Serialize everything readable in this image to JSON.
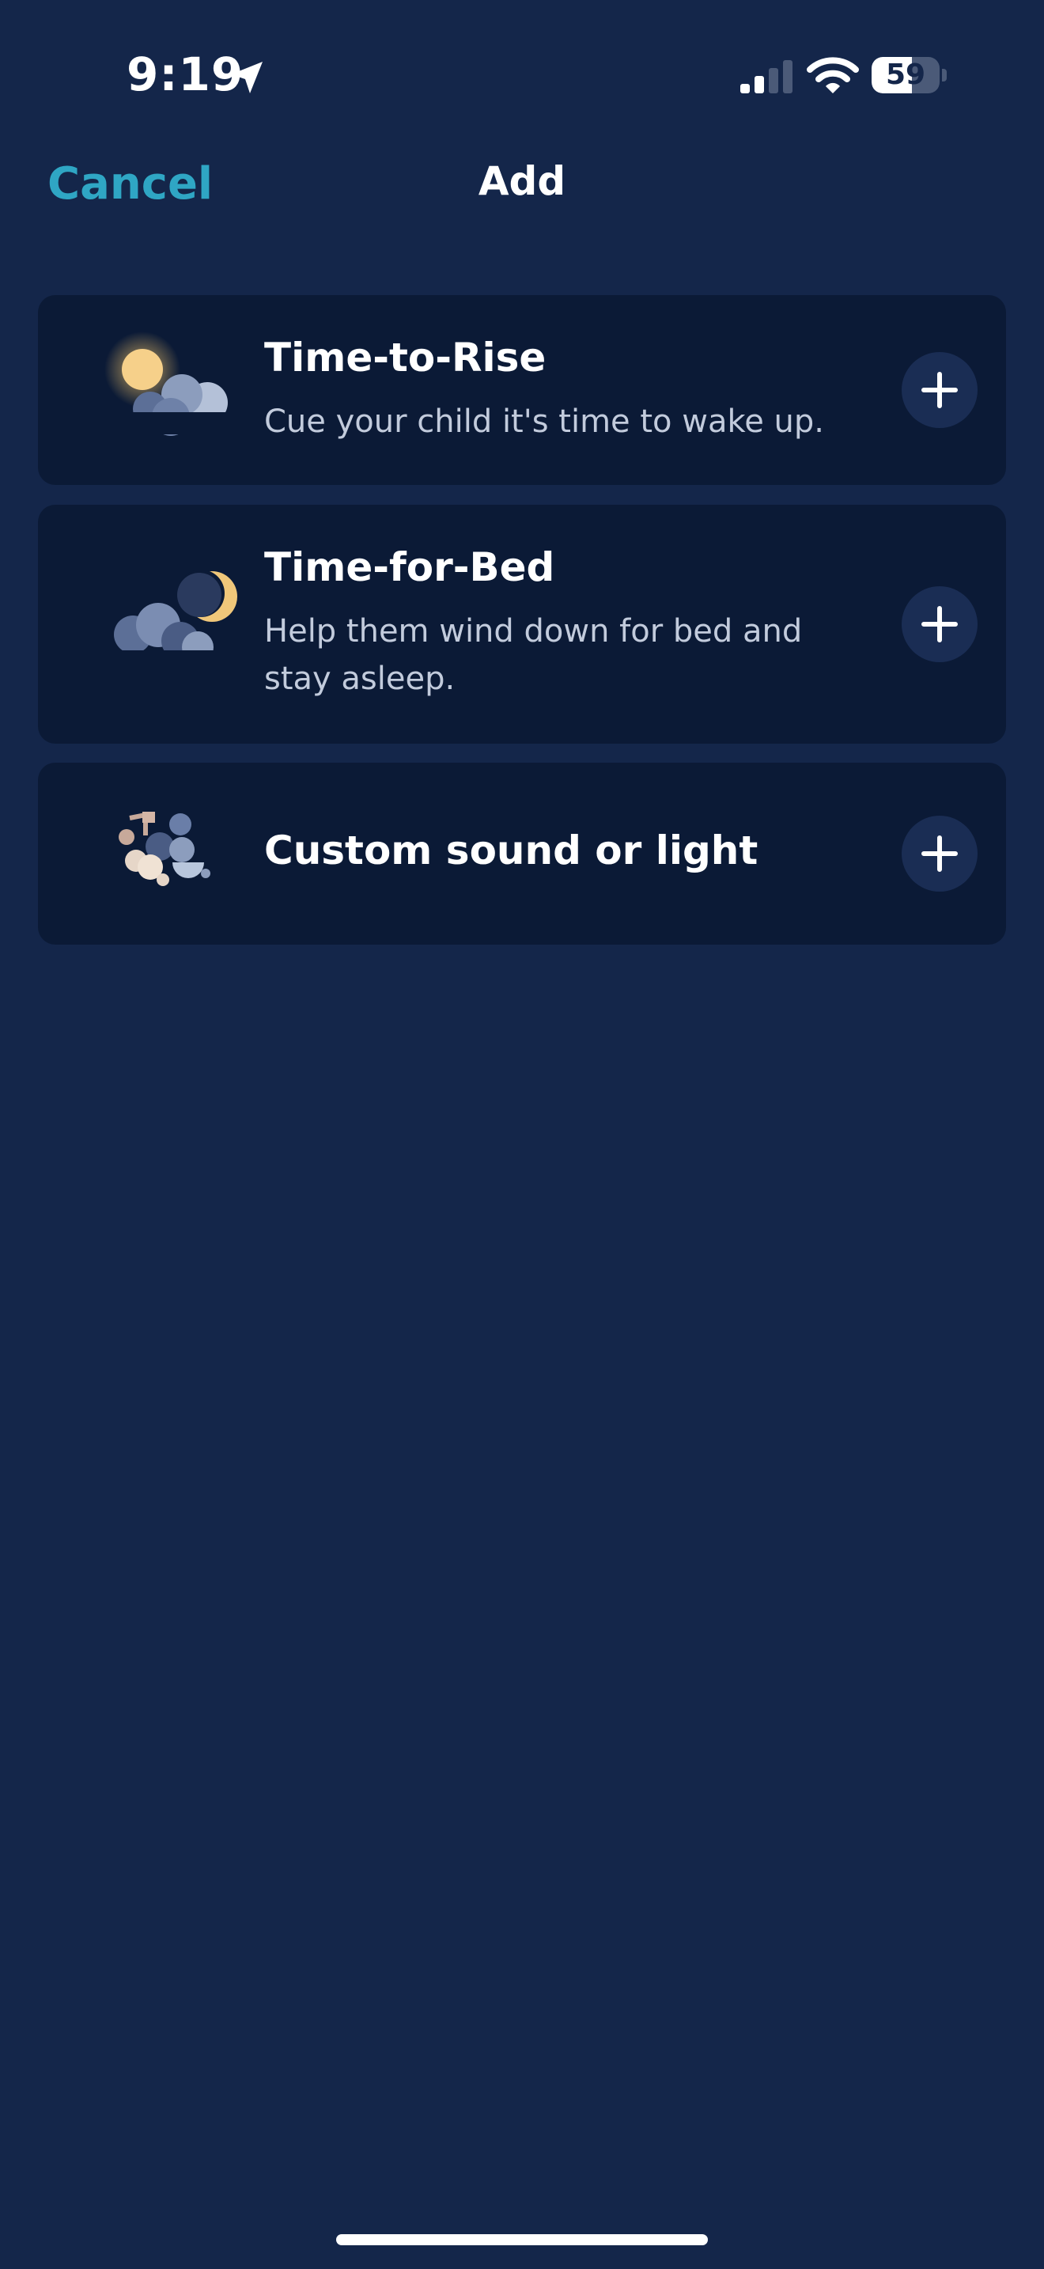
{
  "status_bar": {
    "time": "9:19",
    "battery_level": 59,
    "battery_label": "59",
    "icons": {
      "location": "location-arrow-icon",
      "signal": "cellular-signal-icon",
      "wifi": "wifi-icon",
      "battery": "battery-icon"
    }
  },
  "nav": {
    "cancel_label": "Cancel",
    "title": "Add"
  },
  "options": [
    {
      "title": "Time-to-Rise",
      "description": "Cue your child it's time to wake up.",
      "icon": "sun-clouds-icon",
      "action_icon": "plus-icon"
    },
    {
      "title": "Time-for-Bed",
      "description": "Help them wind down for bed and stay asleep.",
      "icon": "moon-clouds-icon",
      "action_icon": "plus-icon"
    },
    {
      "title": "Custom sound or light",
      "description": "",
      "icon": "music-note-shapes-icon",
      "action_icon": "plus-icon"
    }
  ],
  "colors": {
    "background": "#14264a",
    "card_background": "#0b1a36",
    "accent": "#2fa6c4",
    "button_background": "#1a2d54",
    "secondary_text": "#c2cbdc"
  }
}
